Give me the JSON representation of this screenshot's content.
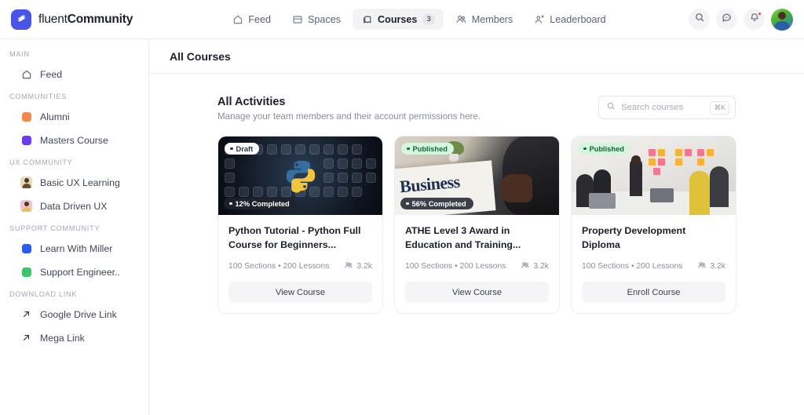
{
  "brand": {
    "light": "fluent",
    "bold": "Community",
    "logo_icon": "fluent-logo-icon"
  },
  "topnav": {
    "items": [
      {
        "label": "Feed",
        "icon": "home-icon",
        "active": false,
        "badge": ""
      },
      {
        "label": "Spaces",
        "icon": "layers-icon",
        "active": false,
        "badge": ""
      },
      {
        "label": "Courses",
        "icon": "cards-stack-icon",
        "active": true,
        "badge": "3"
      },
      {
        "label": "Members",
        "icon": "users-group-icon",
        "active": false,
        "badge": ""
      },
      {
        "label": "Leaderboard",
        "icon": "user-badge-icon",
        "active": false,
        "badge": ""
      }
    ]
  },
  "header_actions": {
    "search_icon": "search-icon",
    "messages_icon": "chat-bubble-icon",
    "notifications_icon": "bell-icon",
    "notification_dot": true,
    "avatar": "user-avatar"
  },
  "sidebar": {
    "groups": [
      {
        "title": "MAIN",
        "items": [
          {
            "label": "Feed",
            "icon": "home-icon",
            "icon_type": "outline",
            "color": ""
          }
        ]
      },
      {
        "title": "COMMUNITIES",
        "items": [
          {
            "label": "Alumni",
            "icon": "square-swatch",
            "icon_type": "swatch",
            "color": "#F2894A"
          },
          {
            "label": "Masters Course",
            "icon": "square-swatch",
            "icon_type": "swatch",
            "color": "#6B3BF0"
          }
        ]
      },
      {
        "title": "UX COMMUNITY",
        "items": [
          {
            "label": "Basic UX Learning",
            "icon": "avatar-thumbnail",
            "icon_type": "avatar",
            "color": "#E8D9B8"
          },
          {
            "label": "Data Driven UX",
            "icon": "avatar-thumbnail",
            "icon_type": "avatar",
            "color": "#F2C3CE"
          }
        ]
      },
      {
        "title": "SUPPORT COMMUNITY",
        "items": [
          {
            "label": "Learn With Miller",
            "icon": "square-swatch",
            "icon_type": "swatch",
            "color": "#2B5BF0"
          },
          {
            "label": "Support Engineer..",
            "icon": "square-swatch",
            "icon_type": "swatch",
            "color": "#3BC56B"
          }
        ]
      },
      {
        "title": "DOWNLOAD LINK",
        "items": [
          {
            "label": "Google Drive Link",
            "icon": "arrow-up-right-icon",
            "icon_type": "arrow",
            "color": ""
          },
          {
            "label": "Mega Link",
            "icon": "arrow-up-right-icon",
            "icon_type": "arrow",
            "color": ""
          }
        ]
      }
    ]
  },
  "page": {
    "title": "All Courses"
  },
  "section": {
    "title": "All Activities",
    "subtitle": "Manage your team members and their account permissions here."
  },
  "search": {
    "placeholder": "Search courses",
    "value": "",
    "shortcut": "⌘K",
    "icon": "search-icon"
  },
  "courses": [
    {
      "status": "Draft",
      "status_kind": "draft",
      "progress": "12% Completed",
      "has_progress": true,
      "title": "Python Tutorial - Python Full Course for Beginners...",
      "sections": "100 Sections",
      "separator": "•",
      "lessons": "200 Lessons",
      "enrolled": "3.2k",
      "enrolled_icon": "users-group-icon",
      "action": "View Course",
      "media": "python-course-thumbnail"
    },
    {
      "status": "Published",
      "status_kind": "published",
      "progress": "56% Completed",
      "has_progress": true,
      "title": "ATHE Level 3 Award in Education and Training...",
      "sections": "100 Sections",
      "separator": "•",
      "lessons": "200 Lessons",
      "enrolled": "3.2k",
      "enrolled_icon": "users-group-icon",
      "action": "View Course",
      "media": "business-newspaper-thumbnail"
    },
    {
      "status": "Published",
      "status_kind": "published",
      "progress": "",
      "has_progress": false,
      "title": "Property Development Diploma",
      "sections": "100 Sections",
      "separator": "•",
      "lessons": "200 Lessons",
      "enrolled": "3.2k",
      "enrolled_icon": "users-group-icon",
      "action": "Enroll Course",
      "media": "team-workshop-thumbnail"
    }
  ],
  "colors": {
    "brand": "#4A55E8",
    "published_badge_bg": "#D6F5DF",
    "published_badge_text": "#17663A",
    "notification_dot": "#EF4444",
    "active_nav_bg": "#F3F3F6"
  }
}
